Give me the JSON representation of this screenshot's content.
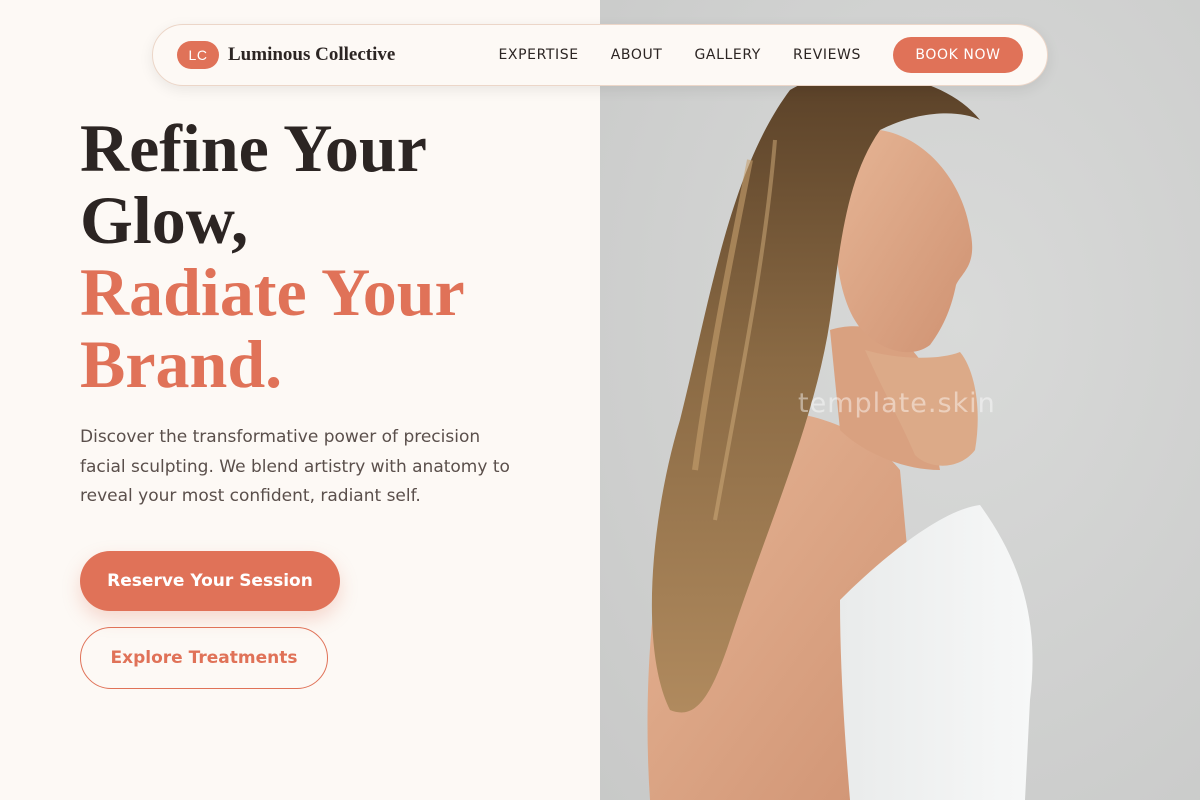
{
  "nav": {
    "logo_initials": "LC",
    "brand_name": "Luminous Collective",
    "links": [
      "EXPERTISE",
      "ABOUT",
      "GALLERY",
      "REVIEWS"
    ],
    "cta_label": "BOOK NOW"
  },
  "hero": {
    "headline_line1": "Refine Your",
    "headline_line2": "Glow,",
    "headline_accent_line1": "Radiate Your",
    "headline_accent_line2": "Brand.",
    "description": "Discover the transformative power of precision facial sculpting. We blend artistry with anatomy to reveal your most confident, radiant self.",
    "primary_button": "Reserve Your Session",
    "secondary_button": "Explore Treatments"
  },
  "photo": {
    "watermark": "template.skin"
  },
  "colors": {
    "accent": "#e07258",
    "text_dark": "#2c2523",
    "background": "#fdf9f5"
  }
}
